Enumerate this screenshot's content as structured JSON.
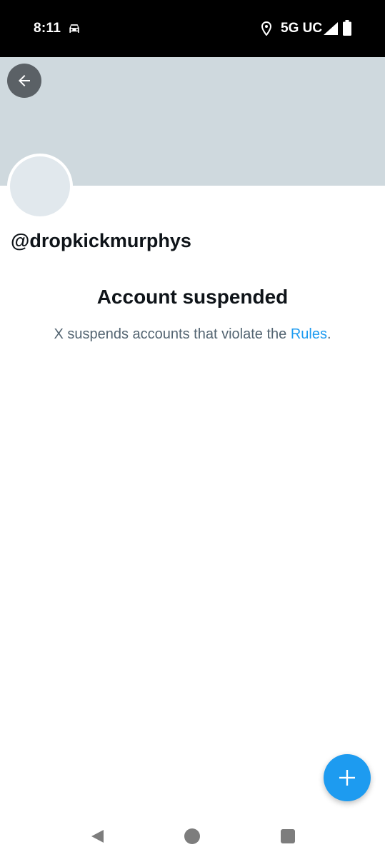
{
  "status_bar": {
    "time": "8:11",
    "network": "5G UC",
    "icons": [
      "car-icon",
      "location-icon",
      "signal-icon",
      "battery-icon"
    ]
  },
  "header": {
    "back_icon": "arrow-left-icon",
    "banner_color": "#cfd9de"
  },
  "profile": {
    "handle": "@dropkickmurphys"
  },
  "suspension": {
    "title": "Account suspended",
    "text_before": "X suspends accounts that violate the ",
    "link_label": "Rules",
    "text_after": "."
  },
  "fab": {
    "icon": "plus-icon",
    "color": "#1d9bf0"
  },
  "nav_bar": {
    "icons": [
      "nav-back-icon",
      "nav-home-icon",
      "nav-recents-icon"
    ]
  }
}
